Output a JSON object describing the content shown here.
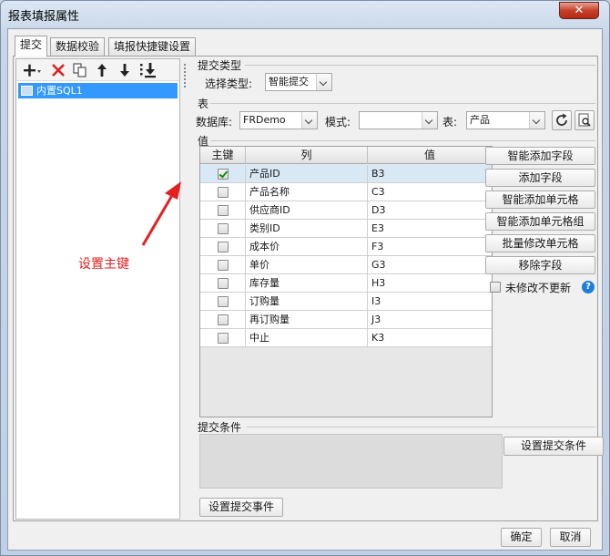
{
  "window": {
    "title": "报表填报属性",
    "close_glyph": "✕"
  },
  "tabs": [
    {
      "label": "提交"
    },
    {
      "label": "数据校验"
    },
    {
      "label": "填报快捷键设置"
    }
  ],
  "left_pane": {
    "toolbar_icons": [
      "add-dropdown-icon",
      "delete-icon",
      "copy-icon",
      "move-up-icon",
      "move-down-icon",
      "move-bottom-icon"
    ],
    "items": [
      {
        "label": "内置SQL1",
        "selected": true
      }
    ]
  },
  "submit_type": {
    "group": "提交类型",
    "label": "选择类型:",
    "value": "智能提交"
  },
  "table_group": {
    "group": "表",
    "db_label": "数据库:",
    "db_value": "FRDemo",
    "schema_label": "模式:",
    "schema_value": "",
    "table_label": "表:",
    "table_value": "产品"
  },
  "values_group": {
    "group": "值",
    "headers": {
      "key": "主键",
      "column": "列",
      "value": "值"
    },
    "rows": [
      {
        "key": true,
        "column": "产品ID",
        "value": "B3"
      },
      {
        "key": false,
        "column": "产品名称",
        "value": "C3"
      },
      {
        "key": false,
        "column": "供应商ID",
        "value": "D3"
      },
      {
        "key": false,
        "column": "类别ID",
        "value": "E3"
      },
      {
        "key": false,
        "column": "成本价",
        "value": "F3"
      },
      {
        "key": false,
        "column": "单价",
        "value": "G3"
      },
      {
        "key": false,
        "column": "库存量",
        "value": "H3"
      },
      {
        "key": false,
        "column": "订购量",
        "value": "I3"
      },
      {
        "key": false,
        "column": "再订购量",
        "value": "J3"
      },
      {
        "key": false,
        "column": "中止",
        "value": "K3"
      }
    ]
  },
  "side_buttons": [
    "智能添加字段",
    "添加字段",
    "智能添加单元格",
    "智能添加单元格组",
    "批量修改单元格",
    "移除字段"
  ],
  "no_update_label": "未修改不更新",
  "condition": {
    "group": "提交条件",
    "button": "设置提交条件"
  },
  "event_button": "设置提交事件",
  "annotation": "设置主键",
  "footer": {
    "ok": "确定",
    "cancel": "取消"
  },
  "colors": {
    "selection": "#3399ff",
    "annotation": "#e32020",
    "help": "#1f7fd8"
  }
}
